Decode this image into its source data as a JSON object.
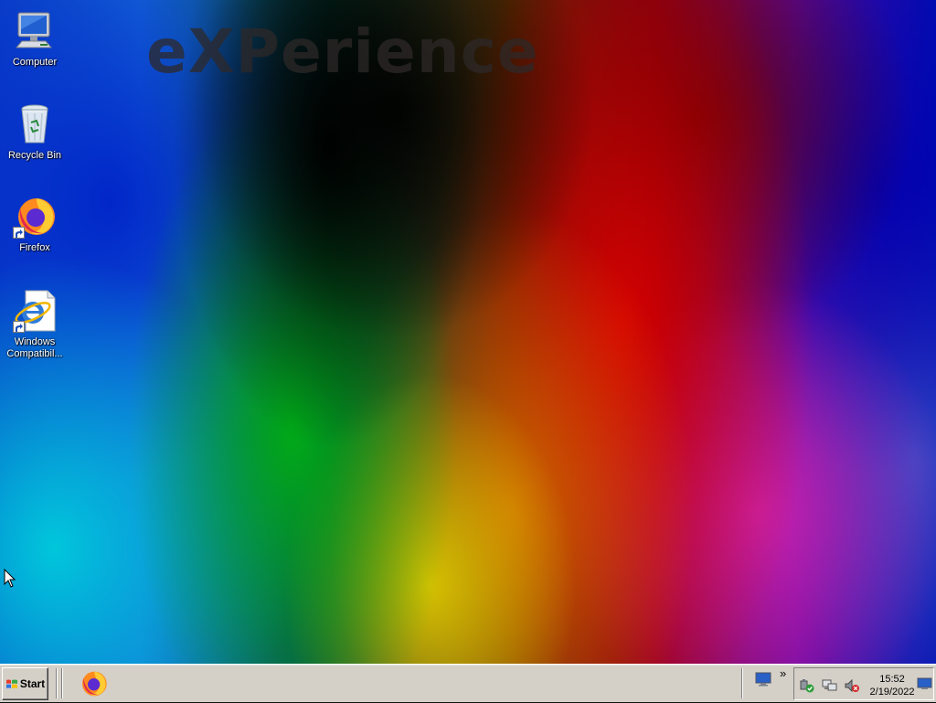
{
  "wallpaper": {
    "watermark_text": "eXPerience"
  },
  "desktop_icons": [
    {
      "label": "Computer",
      "icon": "computer-icon"
    },
    {
      "label": "Recycle Bin",
      "icon": "recycle-bin-icon"
    },
    {
      "label": "Firefox",
      "icon": "firefox-icon"
    },
    {
      "label": "Windows Compatibil...",
      "icon": "internet-explorer-icon"
    }
  ],
  "taskbar": {
    "start_label": "Start",
    "quick_launch": [
      {
        "icon": "firefox-icon"
      }
    ],
    "overflow_symbol": "»",
    "tray_icons": [
      "safely-remove-hardware-icon",
      "network-icon",
      "volume-muted-icon"
    ],
    "clock": {
      "time": "15:52",
      "date": "2/19/2022"
    }
  },
  "colors": {
    "taskbar_bg": "#d4d0c8",
    "label_text": "#ffffff"
  }
}
